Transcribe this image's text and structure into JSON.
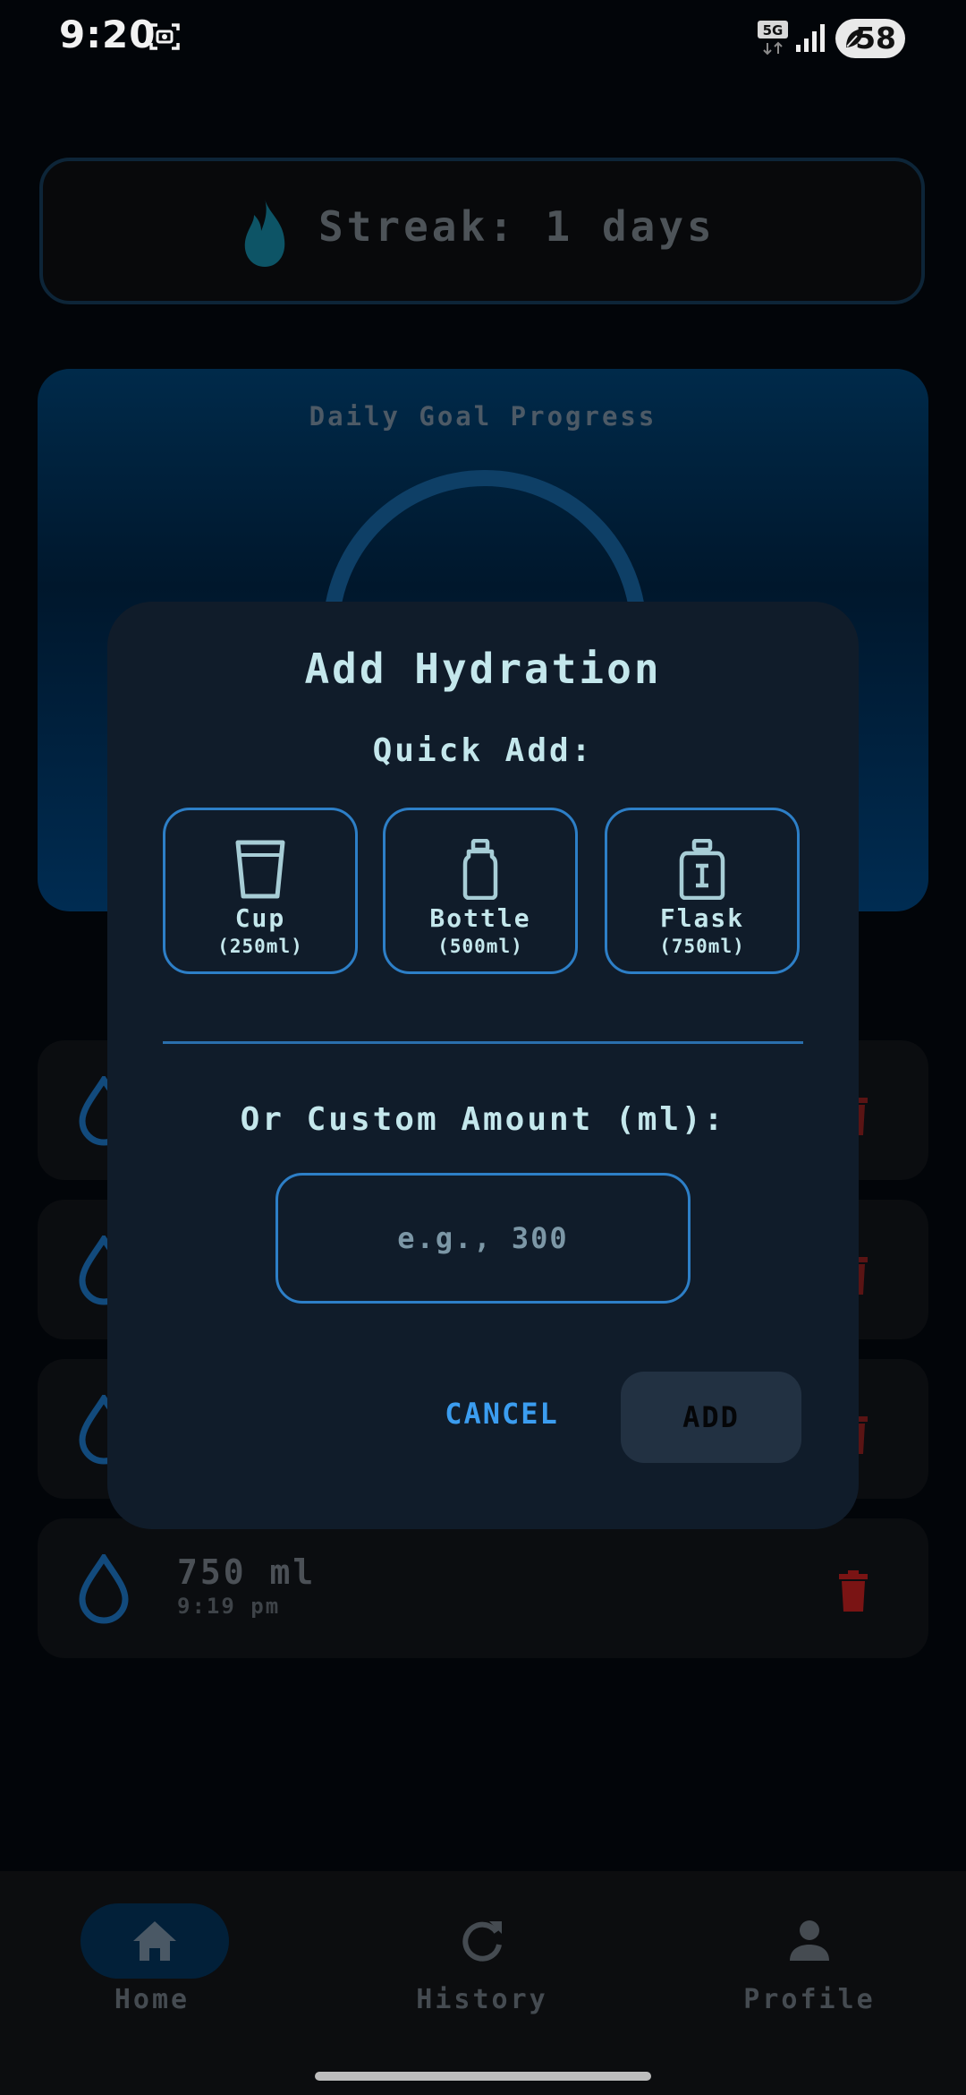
{
  "status_bar": {
    "time": "9:20",
    "network": "5G",
    "battery": "58"
  },
  "streak": {
    "text": "Streak: 1 days"
  },
  "progress": {
    "label": "Daily Goal Progress"
  },
  "log": {
    "entries": [
      {
        "amount": "",
        "time": ""
      },
      {
        "amount": "",
        "time": ""
      },
      {
        "amount": "",
        "time": ""
      },
      {
        "amount": "750 ml",
        "time": "9:19 pm"
      }
    ]
  },
  "modal": {
    "title": "Add Hydration",
    "quick_add_label": "Quick Add:",
    "quick_options": [
      {
        "name": "Cup",
        "volume": "(250ml)",
        "icon": "cup-icon"
      },
      {
        "name": "Bottle",
        "volume": "(500ml)",
        "icon": "bottle-icon"
      },
      {
        "name": "Flask",
        "volume": "(750ml)",
        "icon": "flask-icon"
      }
    ],
    "custom_label": "Or Custom Amount (ml):",
    "custom_placeholder": "e.g., 300",
    "cancel_label": "CANCEL",
    "add_label": "ADD"
  },
  "nav": {
    "items": [
      {
        "label": "Home",
        "icon": "home-icon",
        "active": true
      },
      {
        "label": "History",
        "icon": "refresh-icon",
        "active": false
      },
      {
        "label": "Profile",
        "icon": "person-icon",
        "active": false
      }
    ]
  },
  "colors": {
    "accent": "#2d7fc7",
    "modal_text": "#c4e7ec",
    "danger": "#7a1414",
    "background": "#020509"
  }
}
